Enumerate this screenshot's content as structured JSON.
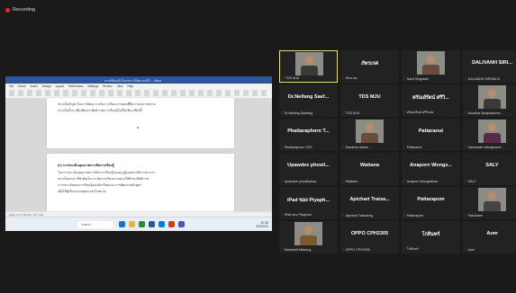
{
  "recording": {
    "label": "Recording"
  },
  "shared_screen": {
    "window_title": "การเขียนเค้าโครงร่างวิจัยระยะที่ 1 - Word",
    "ribbon_tabs": [
      "File",
      "Home",
      "Insert",
      "Design",
      "Layout",
      "References",
      "Mailings",
      "Review",
      "View",
      "Help"
    ],
    "page1_lines": [
      "ประเด็นปัญหาในการพัฒนาระดับการเรียนการสอนที่มีความหลากหลาย",
      "ประเด็นอื่นๆ เพื่อเพิ่มประสิทธิภาพการเรียนรู้ในชั้นเรียน มีดังนี้"
    ],
    "page2_heading": "(ก) การประเมินคุณภาพการจัดการเรียนรู้",
    "page2_lines": [
      "ในการประเมินคุณภาพการจัดการเรียนรู้ของครู ผู้สอนควรพิจารณาจาก",
      "ประเด็นต่างๆ ที่สำคัญในการจัดการเรียนการสอนให้มีประสิทธิภาพ",
      "การประเมินผลการเรียนรู้ของนักเรียนและการพัฒนาหลักสูตร",
      "เพื่อให้ผู้เรียนบรรลุผลตามเป้าหมาย"
    ],
    "status_text": "Page 2 of 3   Words: 412   Thai",
    "taskbar_search": "Search",
    "taskbar_time": "10:35",
    "taskbar_date": "3/2/2024"
  },
  "participants": [
    {
      "name": "",
      "label": "TDS MJU",
      "video": true
    },
    {
      "name": "ภัทรเกศ",
      "label": "ภัทรเกศ"
    },
    {
      "name": "",
      "label": "Sasit Singsaeb",
      "video": true
    },
    {
      "name": "DALIVANH SIRI...",
      "label": "DALIVANH SIRISACK"
    },
    {
      "name": "Dr.Neifang Saef...",
      "label": "Dr.Neifang Saefang"
    },
    {
      "name": "TDS MJU",
      "label": "TDS MJU"
    },
    {
      "name": "ศรัณย์รัตน์ ศรีวิ...",
      "label": "ศรัณย์รัตน์ ศรีวิเศษ"
    },
    {
      "name": "",
      "label": "Aunaiha Saraphancha...",
      "video": true
    },
    {
      "name": "Phattaraphorn T...",
      "label": "Phattaraphorn TDS"
    },
    {
      "name": "",
      "label": "Kawinna Hasse...",
      "video": true
    },
    {
      "name": "Pattaranut",
      "label": "Pattaranut"
    },
    {
      "name": "",
      "label": "Kanokwan Wangsaard...",
      "video": true
    },
    {
      "name": "Upawdee phosit...",
      "label": "Upawdee phosithphan"
    },
    {
      "name": "Wattana",
      "label": "Wattana"
    },
    {
      "name": "Anaporn Wongs...",
      "label": "Anaporn Wongsathan"
    },
    {
      "name": "SALY",
      "label": "SALY"
    },
    {
      "name": "iPad ของ Piyaph...",
      "label": "iPad ของ Piyaphon"
    },
    {
      "name": "Apichart Traisa...",
      "label": "Apichart Traisaeng"
    },
    {
      "name": "Pattarapom",
      "label": "Pattarapom"
    },
    {
      "name": "",
      "label": "Patcharee",
      "video": true
    },
    {
      "name": "",
      "label": "Kanmanit Mitwong",
      "video": true
    },
    {
      "name": "OPPO CPH2305",
      "label": "OPPO CPH2305"
    },
    {
      "name": "โกสินทร์",
      "label": "โกสินทร์"
    },
    {
      "name": "Aom",
      "label": "Aom"
    }
  ],
  "colors": {
    "background": "#1a1a1a",
    "tile": "#222222",
    "active_border": "#e8e36c",
    "mute_icon": "#e03a3a",
    "word_blue": "#2b579a"
  }
}
